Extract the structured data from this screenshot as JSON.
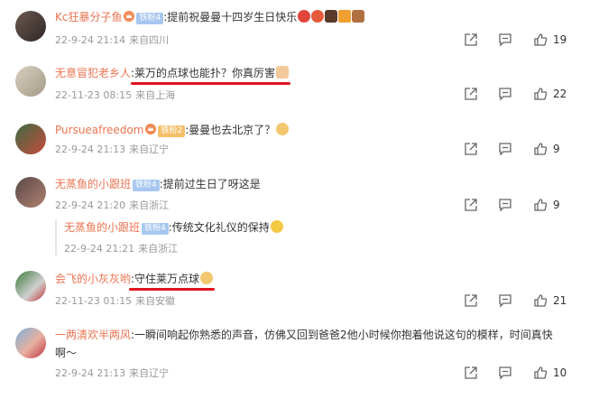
{
  "comments": [
    {
      "user": "Kc狂暴分子鱼",
      "badge": "铁粉4",
      "text": ":提前祝曼曼十四岁生日快乐",
      "date": "22-9-24 21:14",
      "loc": "来自四川",
      "likes": "19"
    },
    {
      "user": "无意冒犯老乡人",
      "badge": "",
      "text": ":莱万的点球也能扑？你真厉害",
      "date": "22-11-23 08:15",
      "loc": "来自上海",
      "likes": "22"
    },
    {
      "user": "Pursueafreedom",
      "badge": "铁粉2",
      "text": ":曼曼也去北京了？",
      "date": "22-9-24 21:13",
      "loc": "来自辽宁",
      "likes": "9"
    },
    {
      "user": "无蒸鱼的小跟班",
      "badge": "铁粉4",
      "text": ":提前过生日了呀这是",
      "date": "22-9-24 21:20",
      "loc": "来自浙江",
      "likes": "9"
    },
    {
      "user": "会飞的小灰灰哟",
      "badge": "",
      "text": ":守住莱万点球",
      "date": "22-11-23 01:15",
      "loc": "来自安徽",
      "likes": "21"
    },
    {
      "user": "一两清欢半两风",
      "badge": "",
      "text": ":一瞬间响起你熟悉的声音，仿佛又回到爸爸2他小时候你抱着他说这句的模样，时间真快",
      "text2": "啊～",
      "date": "22-9-24 21:13",
      "loc": "来自辽宁",
      "likes": "10"
    }
  ],
  "reply": {
    "user": "无蒸鱼的小跟班",
    "badge": "铁粉4",
    "text": ":传统文化礼仪的保持",
    "date": "22-9-24 21:21",
    "loc": "来自浙江"
  },
  "colors": {
    "username": "#eb7350",
    "meta": "#999999",
    "underline": "#e0141e"
  }
}
